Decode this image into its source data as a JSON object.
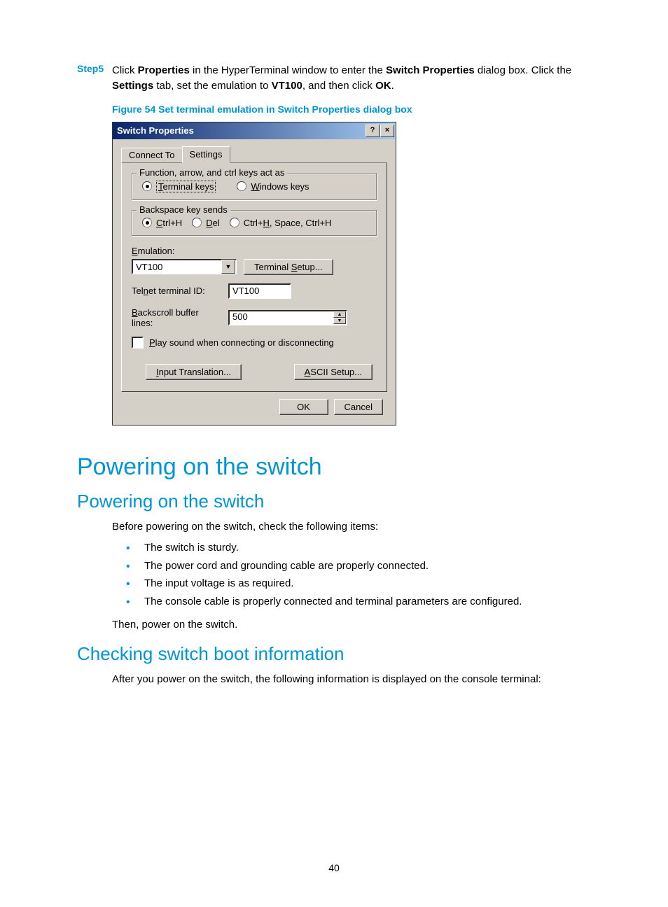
{
  "step": {
    "label": "Step5",
    "text_parts": {
      "p1": "Click ",
      "b1": "Properties",
      "p2": " in the HyperTerminal window to enter the ",
      "b2": "Switch Properties",
      "p3": " dialog box. Click the ",
      "b3": "Settings",
      "p4": " tab, set the emulation to ",
      "b4": "VT100",
      "p5": ", and then click ",
      "b5": "OK",
      "p6": "."
    }
  },
  "figure_caption": "Figure 54 Set terminal emulation in Switch Properties dialog box",
  "dialog": {
    "title": "Switch Properties",
    "help_glyph": "?",
    "close_glyph": "×",
    "tabs": {
      "connect_to": "Connect To",
      "settings": "Settings"
    },
    "group_keys": {
      "legend": "Function, arrow, and ctrl keys act as"
    },
    "radios_keys": {
      "terminal": {
        "prefix": "T",
        "rest": "erminal keys"
      },
      "windows": {
        "prefix": "W",
        "rest": "indows keys"
      }
    },
    "group_backspace": {
      "legend": "Backspace key sends"
    },
    "radios_backspace": {
      "ctrlh": {
        "prefix": "C",
        "rest": "trl+H"
      },
      "del": {
        "prefix": "D",
        "rest": "el"
      },
      "combo": {
        "pre": "Ctrl+",
        "u": "H",
        "post": ", Space, Ctrl+H"
      }
    },
    "emulation": {
      "label_prefix": "E",
      "label_rest": "mulation:",
      "value": "VT100",
      "setup_btn_pre": "Terminal ",
      "setup_btn_u": "S",
      "setup_btn_post": "etup..."
    },
    "telnet_id": {
      "label_pre": "Tel",
      "label_u": "n",
      "label_post": "et terminal ID:",
      "value": "VT100"
    },
    "backscroll": {
      "label_u": "B",
      "label_rest": "ackscroll buffer lines:",
      "value": "500"
    },
    "play_sound": {
      "label_u": "P",
      "label_rest": "lay sound when connecting or disconnecting"
    },
    "input_translation": {
      "u": "I",
      "rest": "nput Translation..."
    },
    "ascii_setup": {
      "u": "A",
      "rest": "SCII Setup..."
    },
    "ok": "OK",
    "cancel": "Cancel"
  },
  "headings": {
    "h1": "Powering on the switch",
    "h2a": "Powering on the switch",
    "h2b": "Checking switch boot information"
  },
  "body": {
    "intro": "Before powering on the switch, check the following items:",
    "bullets": [
      "The switch is sturdy.",
      "The power cord and grounding cable are properly connected.",
      "The input voltage is as required.",
      "The console cable is properly connected and terminal parameters are configured."
    ],
    "then": "Then, power on the switch.",
    "after": "After you power on the switch, the following information is displayed on the console terminal:"
  },
  "page_number": "40"
}
